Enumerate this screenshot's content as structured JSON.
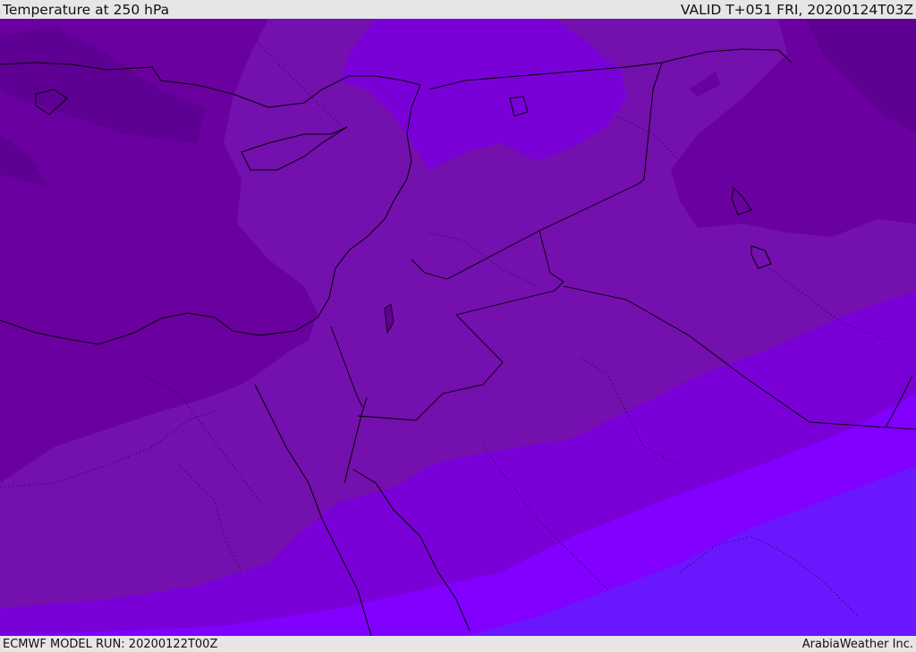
{
  "header": {
    "title": "Temperature at 250 hPa",
    "valid": "VALID T+051 FRI, 20200124T03Z"
  },
  "footer": {
    "model_run": "ECMWF MODEL RUN: 20200122T00Z",
    "credit": "ArabiaWeather Inc."
  },
  "map": {
    "variable": "temperature",
    "level": "250 hPa",
    "palette": {
      "coldest": "#5f0094",
      "cold": "#6a009f",
      "mid": "#7410ad",
      "warm": "#7a00d8",
      "warmer": "#8100ff",
      "warmest": "#6a17ff"
    },
    "line_colors": {
      "coast": "#000000",
      "border": "#000000"
    }
  }
}
